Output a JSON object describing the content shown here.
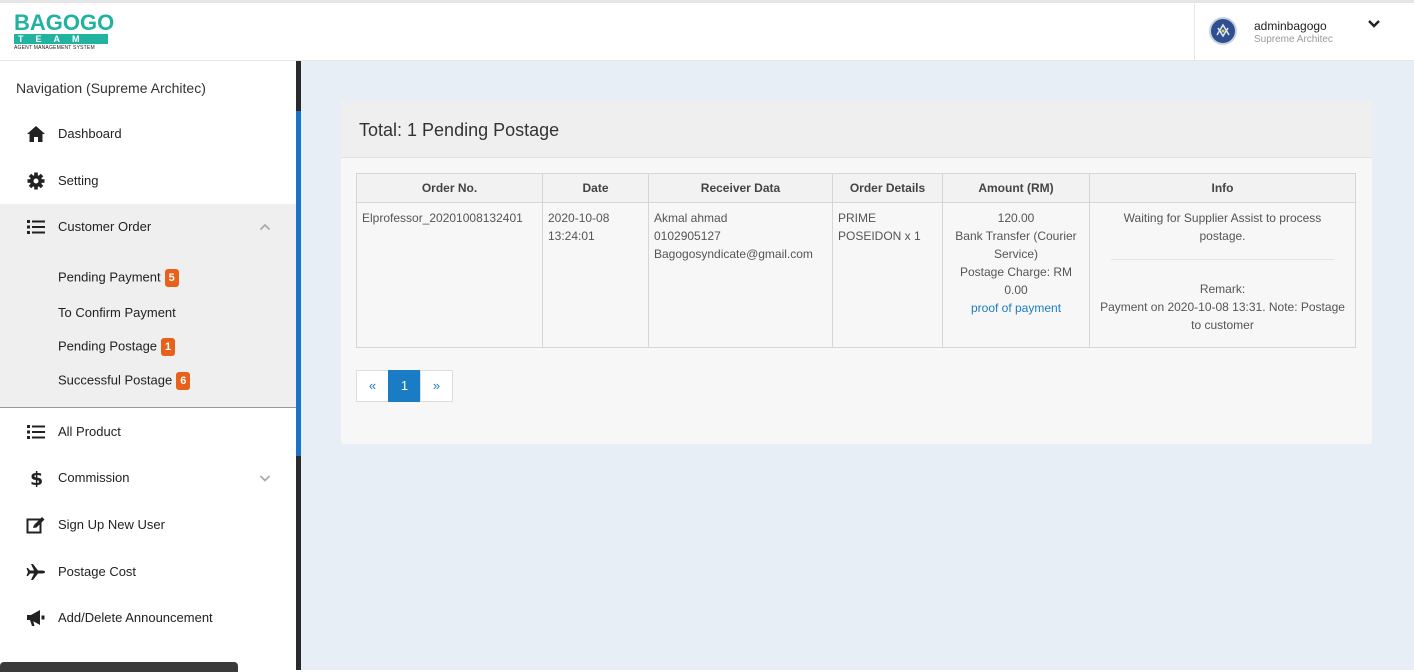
{
  "brand": {
    "line1": "BAGOGO",
    "line2": "TEAM",
    "line3": "AGENT MANAGEMENT SYSTEM"
  },
  "user": {
    "name": "adminbagogo",
    "role": "Supreme Architec"
  },
  "sidebar": {
    "title": "Navigation (Supreme Architec)",
    "items": [
      {
        "label": "Dashboard",
        "icon": "home-icon"
      },
      {
        "label": "Setting",
        "icon": "gear-icon"
      },
      {
        "label": "Customer Order",
        "icon": "list-icon"
      },
      {
        "label": "All Product",
        "icon": "list-icon"
      },
      {
        "label": "Commission",
        "icon": "dollar-icon"
      },
      {
        "label": "Sign Up New User",
        "icon": "edit-icon"
      },
      {
        "label": "Postage Cost",
        "icon": "plane-icon"
      },
      {
        "label": "Add/Delete Announcement",
        "icon": "megaphone-icon"
      }
    ],
    "sub_items": [
      {
        "label": "Pending Payment",
        "badge": "5"
      },
      {
        "label": "To Confirm Payment",
        "badge": ""
      },
      {
        "label": "Pending Postage",
        "badge": "1"
      },
      {
        "label": "Successful Postage",
        "badge": "6"
      }
    ]
  },
  "panel": {
    "title": "Total: 1 Pending Postage"
  },
  "table": {
    "headers": [
      "Order No.",
      "Date",
      "Receiver Data",
      "Order Details",
      "Amount (RM)",
      "Info"
    ],
    "row": {
      "order_no": "Elprofessor_20201008132401",
      "date": "2020-10-08",
      "time": "13:24:01",
      "receiver_name": "Akmal ahmad",
      "receiver_phone": "0102905127",
      "receiver_email": "Bagogosyndicate@gmail.com",
      "order_details": "PRIME POSEIDON x 1",
      "amount": "120.00",
      "payment_method": "Bank Transfer (Courier Service)",
      "postage_charge": "Postage Charge: RM 0.00",
      "proof_link": "proof of payment",
      "info_status": "Waiting for Supplier Assist to process postage.",
      "remark_label": "Remark:",
      "remark_text": "Payment on 2020-10-08 13:31. Note: Postage to customer"
    }
  },
  "pager": {
    "prev": "«",
    "current": "1",
    "next": "»"
  },
  "colors": {
    "accent": "#1a7cc4",
    "badge": "#e8611a",
    "brand": "#21b3a0"
  }
}
